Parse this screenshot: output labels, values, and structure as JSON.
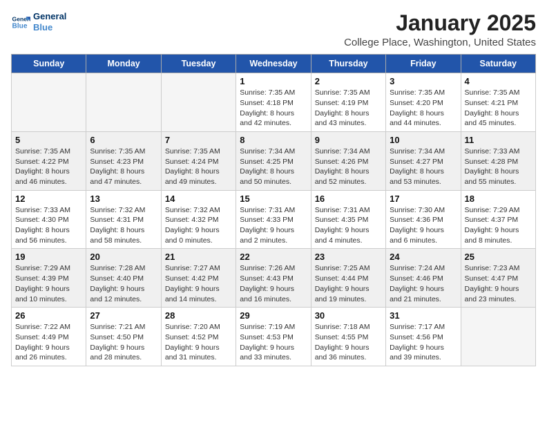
{
  "header": {
    "logo_line1": "General",
    "logo_line2": "Blue",
    "title": "January 2025",
    "location": "College Place, Washington, United States"
  },
  "days_of_week": [
    "Sunday",
    "Monday",
    "Tuesday",
    "Wednesday",
    "Thursday",
    "Friday",
    "Saturday"
  ],
  "weeks": [
    [
      {
        "num": "",
        "sunrise": "",
        "sunset": "",
        "daylight": ""
      },
      {
        "num": "",
        "sunrise": "",
        "sunset": "",
        "daylight": ""
      },
      {
        "num": "",
        "sunrise": "",
        "sunset": "",
        "daylight": ""
      },
      {
        "num": "1",
        "sunrise": "Sunrise: 7:35 AM",
        "sunset": "Sunset: 4:18 PM",
        "daylight": "Daylight: 8 hours and 42 minutes."
      },
      {
        "num": "2",
        "sunrise": "Sunrise: 7:35 AM",
        "sunset": "Sunset: 4:19 PM",
        "daylight": "Daylight: 8 hours and 43 minutes."
      },
      {
        "num": "3",
        "sunrise": "Sunrise: 7:35 AM",
        "sunset": "Sunset: 4:20 PM",
        "daylight": "Daylight: 8 hours and 44 minutes."
      },
      {
        "num": "4",
        "sunrise": "Sunrise: 7:35 AM",
        "sunset": "Sunset: 4:21 PM",
        "daylight": "Daylight: 8 hours and 45 minutes."
      }
    ],
    [
      {
        "num": "5",
        "sunrise": "Sunrise: 7:35 AM",
        "sunset": "Sunset: 4:22 PM",
        "daylight": "Daylight: 8 hours and 46 minutes."
      },
      {
        "num": "6",
        "sunrise": "Sunrise: 7:35 AM",
        "sunset": "Sunset: 4:23 PM",
        "daylight": "Daylight: 8 hours and 47 minutes."
      },
      {
        "num": "7",
        "sunrise": "Sunrise: 7:35 AM",
        "sunset": "Sunset: 4:24 PM",
        "daylight": "Daylight: 8 hours and 49 minutes."
      },
      {
        "num": "8",
        "sunrise": "Sunrise: 7:34 AM",
        "sunset": "Sunset: 4:25 PM",
        "daylight": "Daylight: 8 hours and 50 minutes."
      },
      {
        "num": "9",
        "sunrise": "Sunrise: 7:34 AM",
        "sunset": "Sunset: 4:26 PM",
        "daylight": "Daylight: 8 hours and 52 minutes."
      },
      {
        "num": "10",
        "sunrise": "Sunrise: 7:34 AM",
        "sunset": "Sunset: 4:27 PM",
        "daylight": "Daylight: 8 hours and 53 minutes."
      },
      {
        "num": "11",
        "sunrise": "Sunrise: 7:33 AM",
        "sunset": "Sunset: 4:28 PM",
        "daylight": "Daylight: 8 hours and 55 minutes."
      }
    ],
    [
      {
        "num": "12",
        "sunrise": "Sunrise: 7:33 AM",
        "sunset": "Sunset: 4:30 PM",
        "daylight": "Daylight: 8 hours and 56 minutes."
      },
      {
        "num": "13",
        "sunrise": "Sunrise: 7:32 AM",
        "sunset": "Sunset: 4:31 PM",
        "daylight": "Daylight: 8 hours and 58 minutes."
      },
      {
        "num": "14",
        "sunrise": "Sunrise: 7:32 AM",
        "sunset": "Sunset: 4:32 PM",
        "daylight": "Daylight: 9 hours and 0 minutes."
      },
      {
        "num": "15",
        "sunrise": "Sunrise: 7:31 AM",
        "sunset": "Sunset: 4:33 PM",
        "daylight": "Daylight: 9 hours and 2 minutes."
      },
      {
        "num": "16",
        "sunrise": "Sunrise: 7:31 AM",
        "sunset": "Sunset: 4:35 PM",
        "daylight": "Daylight: 9 hours and 4 minutes."
      },
      {
        "num": "17",
        "sunrise": "Sunrise: 7:30 AM",
        "sunset": "Sunset: 4:36 PM",
        "daylight": "Daylight: 9 hours and 6 minutes."
      },
      {
        "num": "18",
        "sunrise": "Sunrise: 7:29 AM",
        "sunset": "Sunset: 4:37 PM",
        "daylight": "Daylight: 9 hours and 8 minutes."
      }
    ],
    [
      {
        "num": "19",
        "sunrise": "Sunrise: 7:29 AM",
        "sunset": "Sunset: 4:39 PM",
        "daylight": "Daylight: 9 hours and 10 minutes."
      },
      {
        "num": "20",
        "sunrise": "Sunrise: 7:28 AM",
        "sunset": "Sunset: 4:40 PM",
        "daylight": "Daylight: 9 hours and 12 minutes."
      },
      {
        "num": "21",
        "sunrise": "Sunrise: 7:27 AM",
        "sunset": "Sunset: 4:42 PM",
        "daylight": "Daylight: 9 hours and 14 minutes."
      },
      {
        "num": "22",
        "sunrise": "Sunrise: 7:26 AM",
        "sunset": "Sunset: 4:43 PM",
        "daylight": "Daylight: 9 hours and 16 minutes."
      },
      {
        "num": "23",
        "sunrise": "Sunrise: 7:25 AM",
        "sunset": "Sunset: 4:44 PM",
        "daylight": "Daylight: 9 hours and 19 minutes."
      },
      {
        "num": "24",
        "sunrise": "Sunrise: 7:24 AM",
        "sunset": "Sunset: 4:46 PM",
        "daylight": "Daylight: 9 hours and 21 minutes."
      },
      {
        "num": "25",
        "sunrise": "Sunrise: 7:23 AM",
        "sunset": "Sunset: 4:47 PM",
        "daylight": "Daylight: 9 hours and 23 minutes."
      }
    ],
    [
      {
        "num": "26",
        "sunrise": "Sunrise: 7:22 AM",
        "sunset": "Sunset: 4:49 PM",
        "daylight": "Daylight: 9 hours and 26 minutes."
      },
      {
        "num": "27",
        "sunrise": "Sunrise: 7:21 AM",
        "sunset": "Sunset: 4:50 PM",
        "daylight": "Daylight: 9 hours and 28 minutes."
      },
      {
        "num": "28",
        "sunrise": "Sunrise: 7:20 AM",
        "sunset": "Sunset: 4:52 PM",
        "daylight": "Daylight: 9 hours and 31 minutes."
      },
      {
        "num": "29",
        "sunrise": "Sunrise: 7:19 AM",
        "sunset": "Sunset: 4:53 PM",
        "daylight": "Daylight: 9 hours and 33 minutes."
      },
      {
        "num": "30",
        "sunrise": "Sunrise: 7:18 AM",
        "sunset": "Sunset: 4:55 PM",
        "daylight": "Daylight: 9 hours and 36 minutes."
      },
      {
        "num": "31",
        "sunrise": "Sunrise: 7:17 AM",
        "sunset": "Sunset: 4:56 PM",
        "daylight": "Daylight: 9 hours and 39 minutes."
      },
      {
        "num": "",
        "sunrise": "",
        "sunset": "",
        "daylight": ""
      }
    ]
  ]
}
